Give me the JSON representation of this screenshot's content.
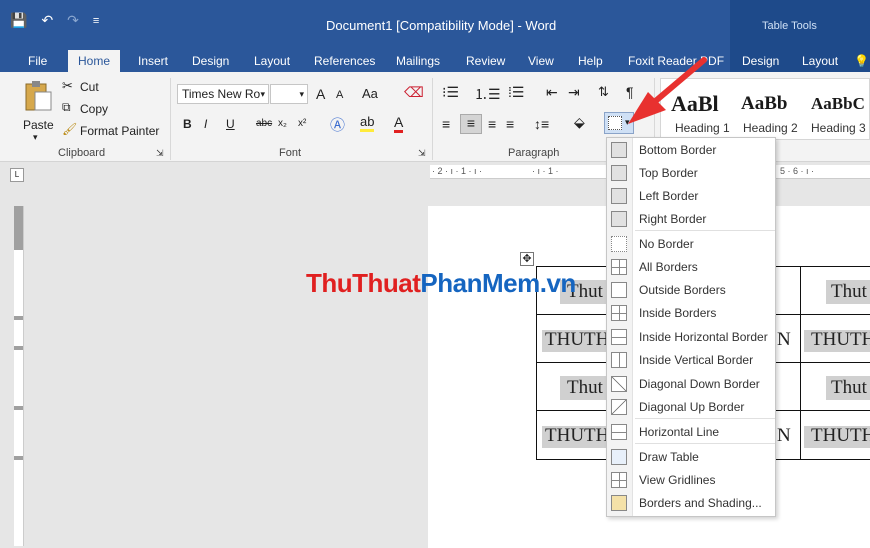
{
  "titlebar": {
    "doc_title": "Document1 [Compatibility Mode]  -  Word",
    "tools_label": "Table Tools",
    "qat_save": "💾",
    "qat_undo": "↶",
    "qat_redo": "↷",
    "qat_more": "≡"
  },
  "tabs": [
    {
      "label": "File"
    },
    {
      "label": "Home"
    },
    {
      "label": "Insert"
    },
    {
      "label": "Design"
    },
    {
      "label": "Layout"
    },
    {
      "label": "References"
    },
    {
      "label": "Mailings"
    },
    {
      "label": "Review"
    },
    {
      "label": "View"
    },
    {
      "label": "Help"
    },
    {
      "label": "Foxit Reader PDF"
    },
    {
      "label": "Design"
    },
    {
      "label": "Layout"
    },
    {
      "label": "💡"
    }
  ],
  "clipboard": {
    "paste": "Paste",
    "cut": "Cut",
    "copy": "Copy",
    "format_painter": "Format Painter",
    "label": "Clipboard"
  },
  "font": {
    "name": "Times New Ro",
    "size": "",
    "bold": "B",
    "italic": "I",
    "underline": "U",
    "strike": "abc",
    "sub": "x₂",
    "sup": "x²",
    "grow": "A",
    "shrink": "A",
    "case": "Aa",
    "label": "Font"
  },
  "paragraph": {
    "label": "Paragraph"
  },
  "styles": [
    {
      "sample": "AaBl",
      "name": "Heading 1"
    },
    {
      "sample": "AaBb",
      "name": "Heading 2"
    },
    {
      "sample": "AaBbC",
      "name": "Heading 3"
    }
  ],
  "ruler": {
    "marks_left": "· 2 · ı · 1 · ı ·",
    "marks_right": "5 · 6 · ı ·",
    "marks_mid": "· ı · 1 ·"
  },
  "table": {
    "r1c1": "Thut",
    "r1c3": "Thut",
    "r2c1": "THUTH",
    "r2c2": "N",
    "r2c3": "THUTH",
    "r3c1": "Thut",
    "r3c3": "Thut",
    "r4c1": "THUTH",
    "r4c2": "N",
    "r4c3": "THUTH"
  },
  "watermark": {
    "part1": "Thu",
    "part2": "Thuat",
    "part3": "PhanMem",
    "part4": ".vn"
  },
  "menu": [
    {
      "label": "Bottom Border",
      "icon": "bottom-border-icon"
    },
    {
      "label": "Top Border",
      "icon": "top-border-icon"
    },
    {
      "label": "Left Border",
      "icon": "left-border-icon"
    },
    {
      "label": "Right Border",
      "icon": "right-border-icon"
    },
    {
      "label": "No Border",
      "icon": "no-border-icon"
    },
    {
      "label": "All Borders",
      "icon": "all-borders-icon"
    },
    {
      "label": "Outside Borders",
      "icon": "outside-borders-icon"
    },
    {
      "label": "Inside Borders",
      "icon": "inside-borders-icon"
    },
    {
      "label": "Inside Horizontal Border",
      "icon": "inside-horizontal-border-icon"
    },
    {
      "label": "Inside Vertical Border",
      "icon": "inside-vertical-border-icon"
    },
    {
      "label": "Diagonal Down Border",
      "icon": "diagonal-down-border-icon"
    },
    {
      "label": "Diagonal Up Border",
      "icon": "diagonal-up-border-icon"
    },
    {
      "label": "Horizontal Line",
      "icon": "horizontal-line-icon"
    },
    {
      "label": "Draw Table",
      "icon": "draw-table-icon"
    },
    {
      "label": "View Gridlines",
      "icon": "view-gridlines-icon"
    },
    {
      "label": "Borders and Shading...",
      "icon": "borders-shading-icon"
    }
  ],
  "colors": {
    "word_blue": "#2b579a",
    "arrow_red": "#e8312f",
    "watermark_red": "#e02020",
    "watermark_blue": "#1565c0"
  }
}
